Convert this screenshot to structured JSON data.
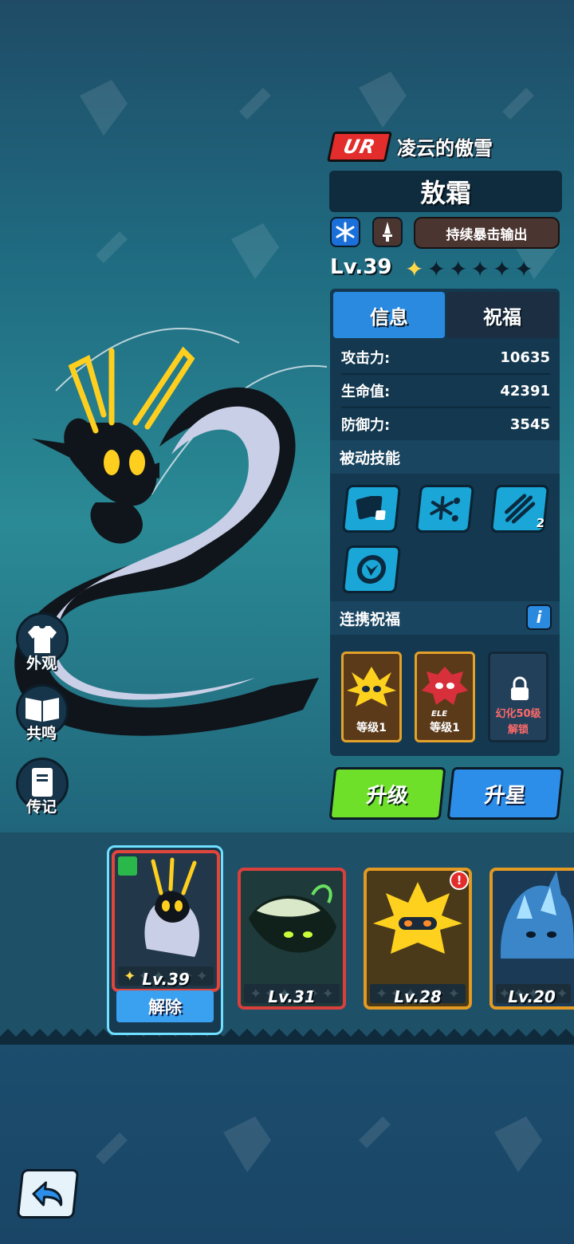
{
  "hero": {
    "rarity": "UR",
    "subtitle": "凌云的傲雪",
    "name": "敖霜",
    "tag": "持续暴击输出",
    "level": "Lv.39",
    "stars_filled": 1,
    "stars_total": 6,
    "element_icon": "snowflake-icon",
    "class_icon": "sword-icon"
  },
  "tabs": {
    "info": "信息",
    "bless": "祝福",
    "active": "info"
  },
  "stats": [
    {
      "label": "攻击力:",
      "value": "10635"
    },
    {
      "label": "生命值:",
      "value": "42391"
    },
    {
      "label": "防御力:",
      "value": "3545"
    }
  ],
  "passive": {
    "title": "被动技能",
    "skills": [
      {
        "icon": "cards-dice-icon"
      },
      {
        "icon": "snowflakes-icon"
      },
      {
        "icon": "claw-slash-icon",
        "count": "2"
      },
      {
        "icon": "dragon-emblem-icon"
      }
    ]
  },
  "link_bless": {
    "title": "连携祝福",
    "info_icon": "i",
    "slots": [
      {
        "label": "等级1",
        "icon": "lightning-creature-icon"
      },
      {
        "label": "等级1",
        "icon": "red-creature-icon",
        "badge": "ELE"
      },
      {
        "label_line1": "幻化50级",
        "label_line2": "解锁",
        "icon": "lock-icon"
      }
    ]
  },
  "actions": {
    "upgrade": "升级",
    "star_up": "升星"
  },
  "side_menu": [
    {
      "label": "外观",
      "icon": "shirt-icon"
    },
    {
      "label": "共鸣",
      "icon": "book-icon"
    },
    {
      "label": "传记",
      "icon": "journal-icon"
    }
  ],
  "roster": [
    {
      "level": "Lv.39",
      "selected": true,
      "action": "解除",
      "stars_filled": 1,
      "border": "#e2463a"
    },
    {
      "level": "Lv.31",
      "selected": false,
      "stars_filled": 0,
      "border": "#d9403c"
    },
    {
      "level": "Lv.28",
      "selected": false,
      "stars_filled": 0,
      "border": "#e39a22",
      "alert": "!"
    },
    {
      "level": "Lv.20",
      "selected": false,
      "stars_filled": 0,
      "border": "#e39a22"
    }
  ],
  "colors": {
    "accent_green": "#6fe02a",
    "accent_blue": "#2c8ee8",
    "rarity_red": "#e32c2c",
    "panel": "#13384f"
  }
}
